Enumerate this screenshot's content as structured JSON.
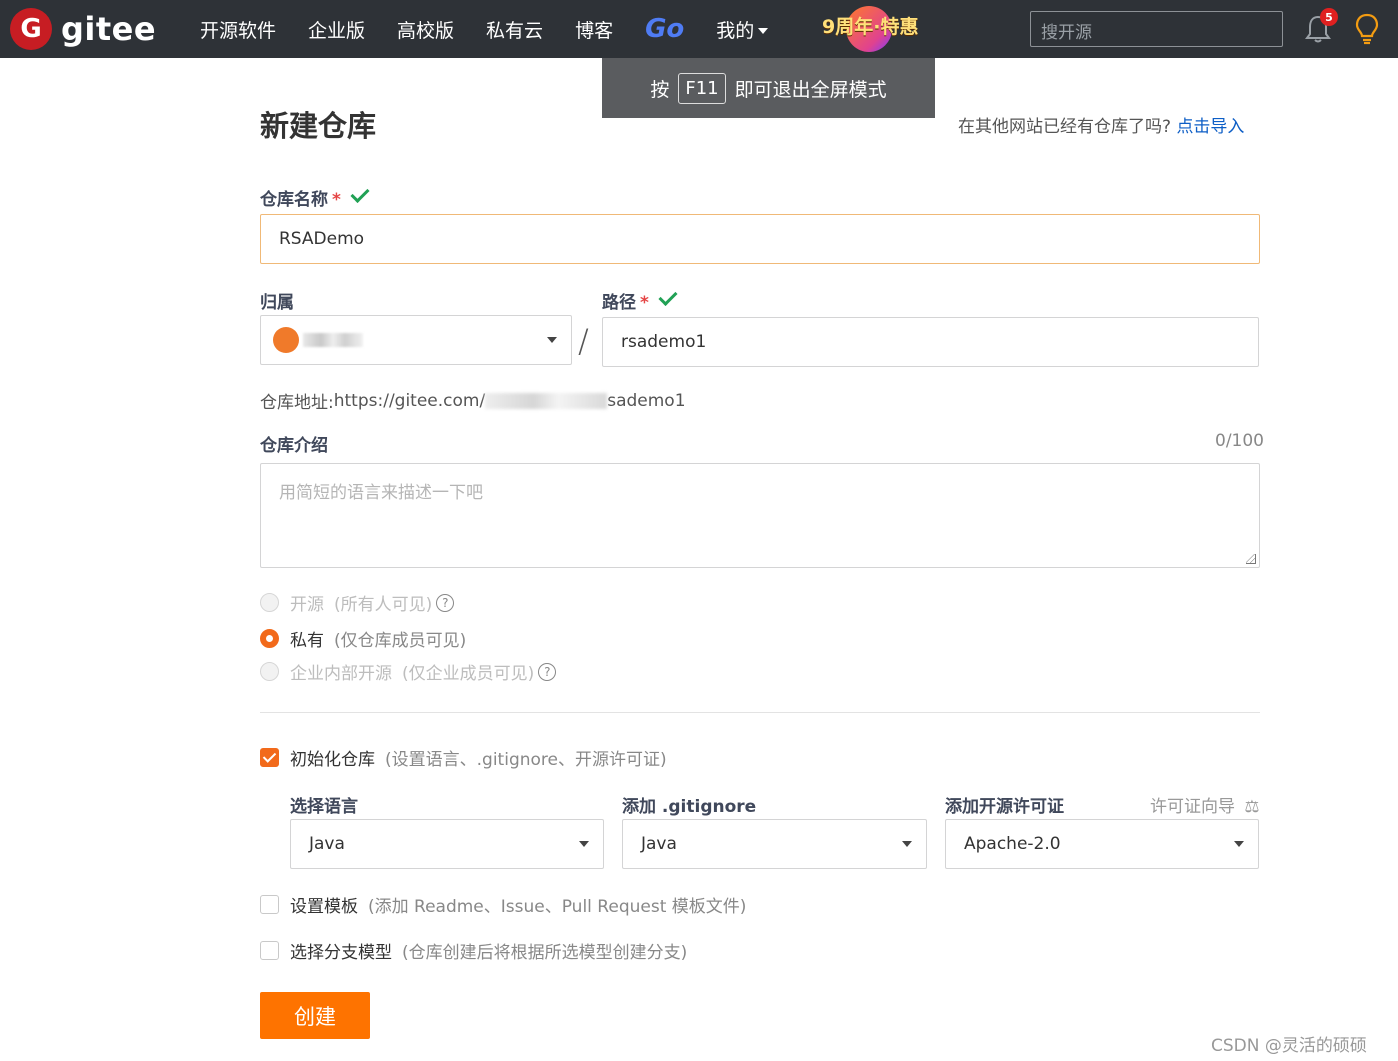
{
  "navbar": {
    "logo_mark": "G",
    "logo_text": "gitee",
    "items": [
      "开源软件",
      "企业版",
      "高校版",
      "私有云",
      "博客"
    ],
    "go_label": "Go",
    "mine_label": "我的",
    "promo_text": "9周年·特惠",
    "search_placeholder": "搜开源",
    "notification_count": "5"
  },
  "toast": {
    "prefix": "按",
    "key": "F11",
    "suffix": "即可退出全屏模式"
  },
  "page": {
    "title": "新建仓库",
    "import_hint": "在其他网站已经有仓库了吗?",
    "import_link": "点击导入"
  },
  "form": {
    "repo_name_label": "仓库名称",
    "repo_name_value": "RSADemo",
    "owner_label": "归属",
    "path_label": "路径",
    "path_value": "rsademo1",
    "path_separator": "/",
    "repo_url_label": "仓库地址:",
    "repo_url_prefix": "https://gitee.com/",
    "repo_url_suffix": "sademo1",
    "intro_label": "仓库介绍",
    "intro_counter": "0/100",
    "intro_placeholder": "用简短的语言来描述一下吧",
    "required_mark": "*"
  },
  "visibility": [
    {
      "label": "开源",
      "note": "(所有人可见)",
      "selected": false,
      "disabled": true,
      "help": "?"
    },
    {
      "label": "私有",
      "note": "(仅仓库成员可见)",
      "selected": true,
      "disabled": false,
      "help": ""
    },
    {
      "label": "企业内部开源",
      "note": "(仅企业成员可见)",
      "selected": false,
      "disabled": true,
      "help": "?"
    }
  ],
  "init": {
    "label": "初始化仓库",
    "note": "(设置语言、.gitignore、开源许可证)",
    "checked": true,
    "language_label": "选择语言",
    "language_value": "Java",
    "gitignore_label": "添加 .gitignore",
    "gitignore_value": "Java",
    "license_label": "添加开源许可证",
    "license_guide": "许可证向导",
    "license_value": "Apache-2.0"
  },
  "template": {
    "label": "设置模板",
    "note": "(添加 Readme、Issue、Pull Request 模板文件)",
    "checked": false
  },
  "branch_model": {
    "label": "选择分支模型",
    "note": "(仓库创建后将根据所选模型创建分支)",
    "checked": false
  },
  "submit_label": "创建",
  "watermark": "CSDN @灵活的硕硕",
  "colors": {
    "navbar_bg": "#2e3237",
    "brand_red": "#c71d23",
    "accent_orange": "#fe7300",
    "link_blue": "#0d5ec6",
    "success_green": "#21a155"
  }
}
